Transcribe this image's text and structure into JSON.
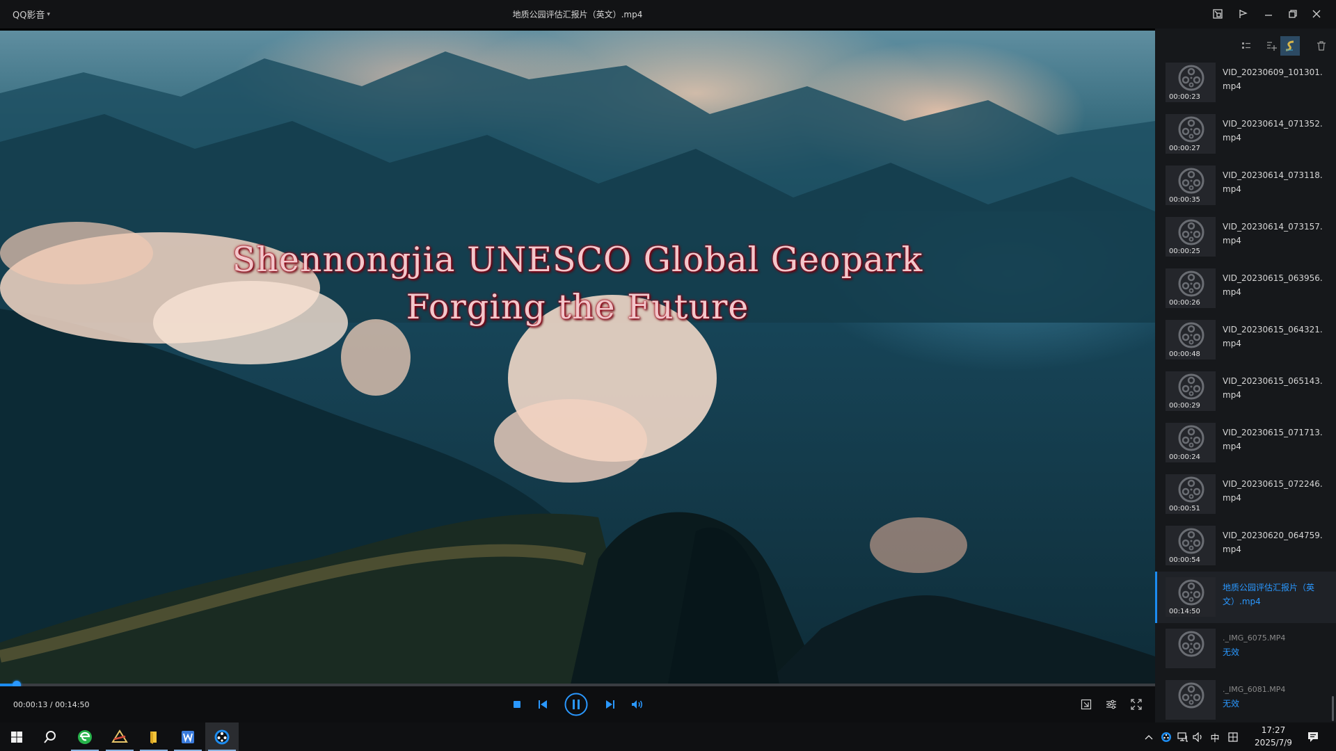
{
  "titlebar": {
    "app_menu": "QQ影音",
    "title": "地质公园评估汇报片（英文）.mp4"
  },
  "video": {
    "subtitle_line1": "Shennongjia UNESCO Global Geopark",
    "subtitle_line2": "Forging the Future"
  },
  "playback": {
    "time_readout": "00:00:13 / 00:14:50",
    "progress_fraction": 0.0146
  },
  "playlist": {
    "items": [
      {
        "name": "VID_20230609_101301.mp4",
        "duration": "00:00:23"
      },
      {
        "name": "VID_20230614_071352.mp4",
        "duration": "00:00:27"
      },
      {
        "name": "VID_20230614_073118.mp4",
        "duration": "00:00:35"
      },
      {
        "name": "VID_20230614_073157.mp4",
        "duration": "00:00:25"
      },
      {
        "name": "VID_20230615_063956.mp4",
        "duration": "00:00:26"
      },
      {
        "name": "VID_20230615_064321.mp4",
        "duration": "00:00:48"
      },
      {
        "name": "VID_20230615_065143.mp4",
        "duration": "00:00:29"
      },
      {
        "name": "VID_20230615_071713.mp4",
        "duration": "00:00:24"
      },
      {
        "name": "VID_20230615_072246.mp4",
        "duration": "00:00:51"
      },
      {
        "name": "VID_20230620_064759.mp4",
        "duration": "00:00:54"
      },
      {
        "name": "地质公园评估汇报片（英文）.mp4",
        "duration": "00:14:50",
        "active": true
      },
      {
        "name": "._IMG_6075.MP4",
        "duration": "",
        "status": "无效"
      },
      {
        "name": "._IMG_6081.MP4",
        "duration": "",
        "status": "无效"
      }
    ]
  },
  "taskbar": {
    "ime_label": "中",
    "time": "17:27",
    "date": "2025/7/9"
  },
  "colors": {
    "accent": "#1c8cf0",
    "subtitle_outline": "#a20016"
  }
}
